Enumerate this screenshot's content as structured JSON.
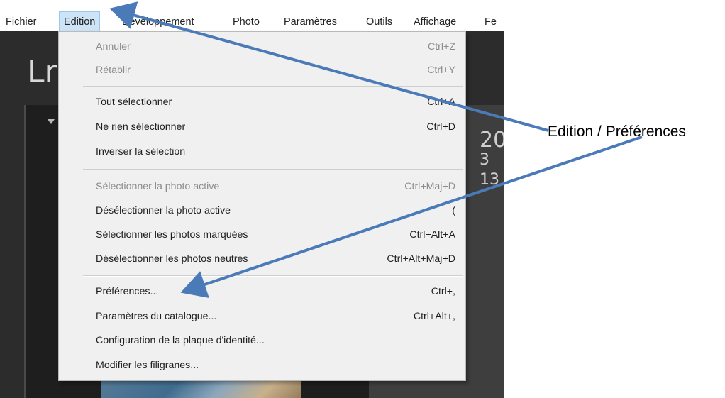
{
  "menubar": {
    "items": [
      {
        "label": "Fichier"
      },
      {
        "label": "Edition"
      },
      {
        "label": "Développement"
      },
      {
        "label": "Photo"
      },
      {
        "label": "Paramètres"
      },
      {
        "label": "Outils"
      },
      {
        "label": "Affichage"
      },
      {
        "label": "Fe"
      }
    ],
    "active": "Edition"
  },
  "app": {
    "logo_text": "Lr",
    "partial_text": [
      "20",
      "3",
      "13"
    ]
  },
  "edit_menu": {
    "groups": [
      [
        {
          "label": "Annuler",
          "shortcut": "Ctrl+Z",
          "enabled": false
        },
        {
          "label": "Rétablir",
          "shortcut": "Ctrl+Y",
          "enabled": false
        }
      ],
      [
        {
          "label": "Tout sélectionner",
          "shortcut": "Ctrl+A",
          "enabled": true
        },
        {
          "label": "Ne rien sélectionner",
          "shortcut": "Ctrl+D",
          "enabled": true
        },
        {
          "label": "Inverser la sélection",
          "shortcut": "",
          "enabled": true
        }
      ],
      [
        {
          "label": "Sélectionner la photo active",
          "shortcut": "Ctrl+Maj+D",
          "enabled": false
        },
        {
          "label": "Désélectionner la photo active",
          "shortcut": "(",
          "enabled": true
        },
        {
          "label": "Sélectionner les photos marquées",
          "shortcut": "Ctrl+Alt+A",
          "enabled": true
        },
        {
          "label": "Désélectionner les photos neutres",
          "shortcut": "Ctrl+Alt+Maj+D",
          "enabled": true
        }
      ],
      [
        {
          "label": "Préférences...",
          "shortcut": "Ctrl+,",
          "enabled": true
        },
        {
          "label": "Paramètres du catalogue...",
          "shortcut": "Ctrl+Alt+,",
          "enabled": true
        },
        {
          "label": "Configuration de la plaque d'identité...",
          "shortcut": "",
          "enabled": true
        },
        {
          "label": "Modifier les filigranes...",
          "shortcut": "",
          "enabled": true
        }
      ]
    ]
  },
  "annotation": {
    "text": "Edition / Préférences",
    "arrow_color": "#4a7ab8"
  },
  "colors": {
    "menubar_active_bg": "#cde3f6",
    "app_dark": "#2c2c2c",
    "menu_bg": "#f0f0f0",
    "disabled_text": "#8c8c8c"
  }
}
